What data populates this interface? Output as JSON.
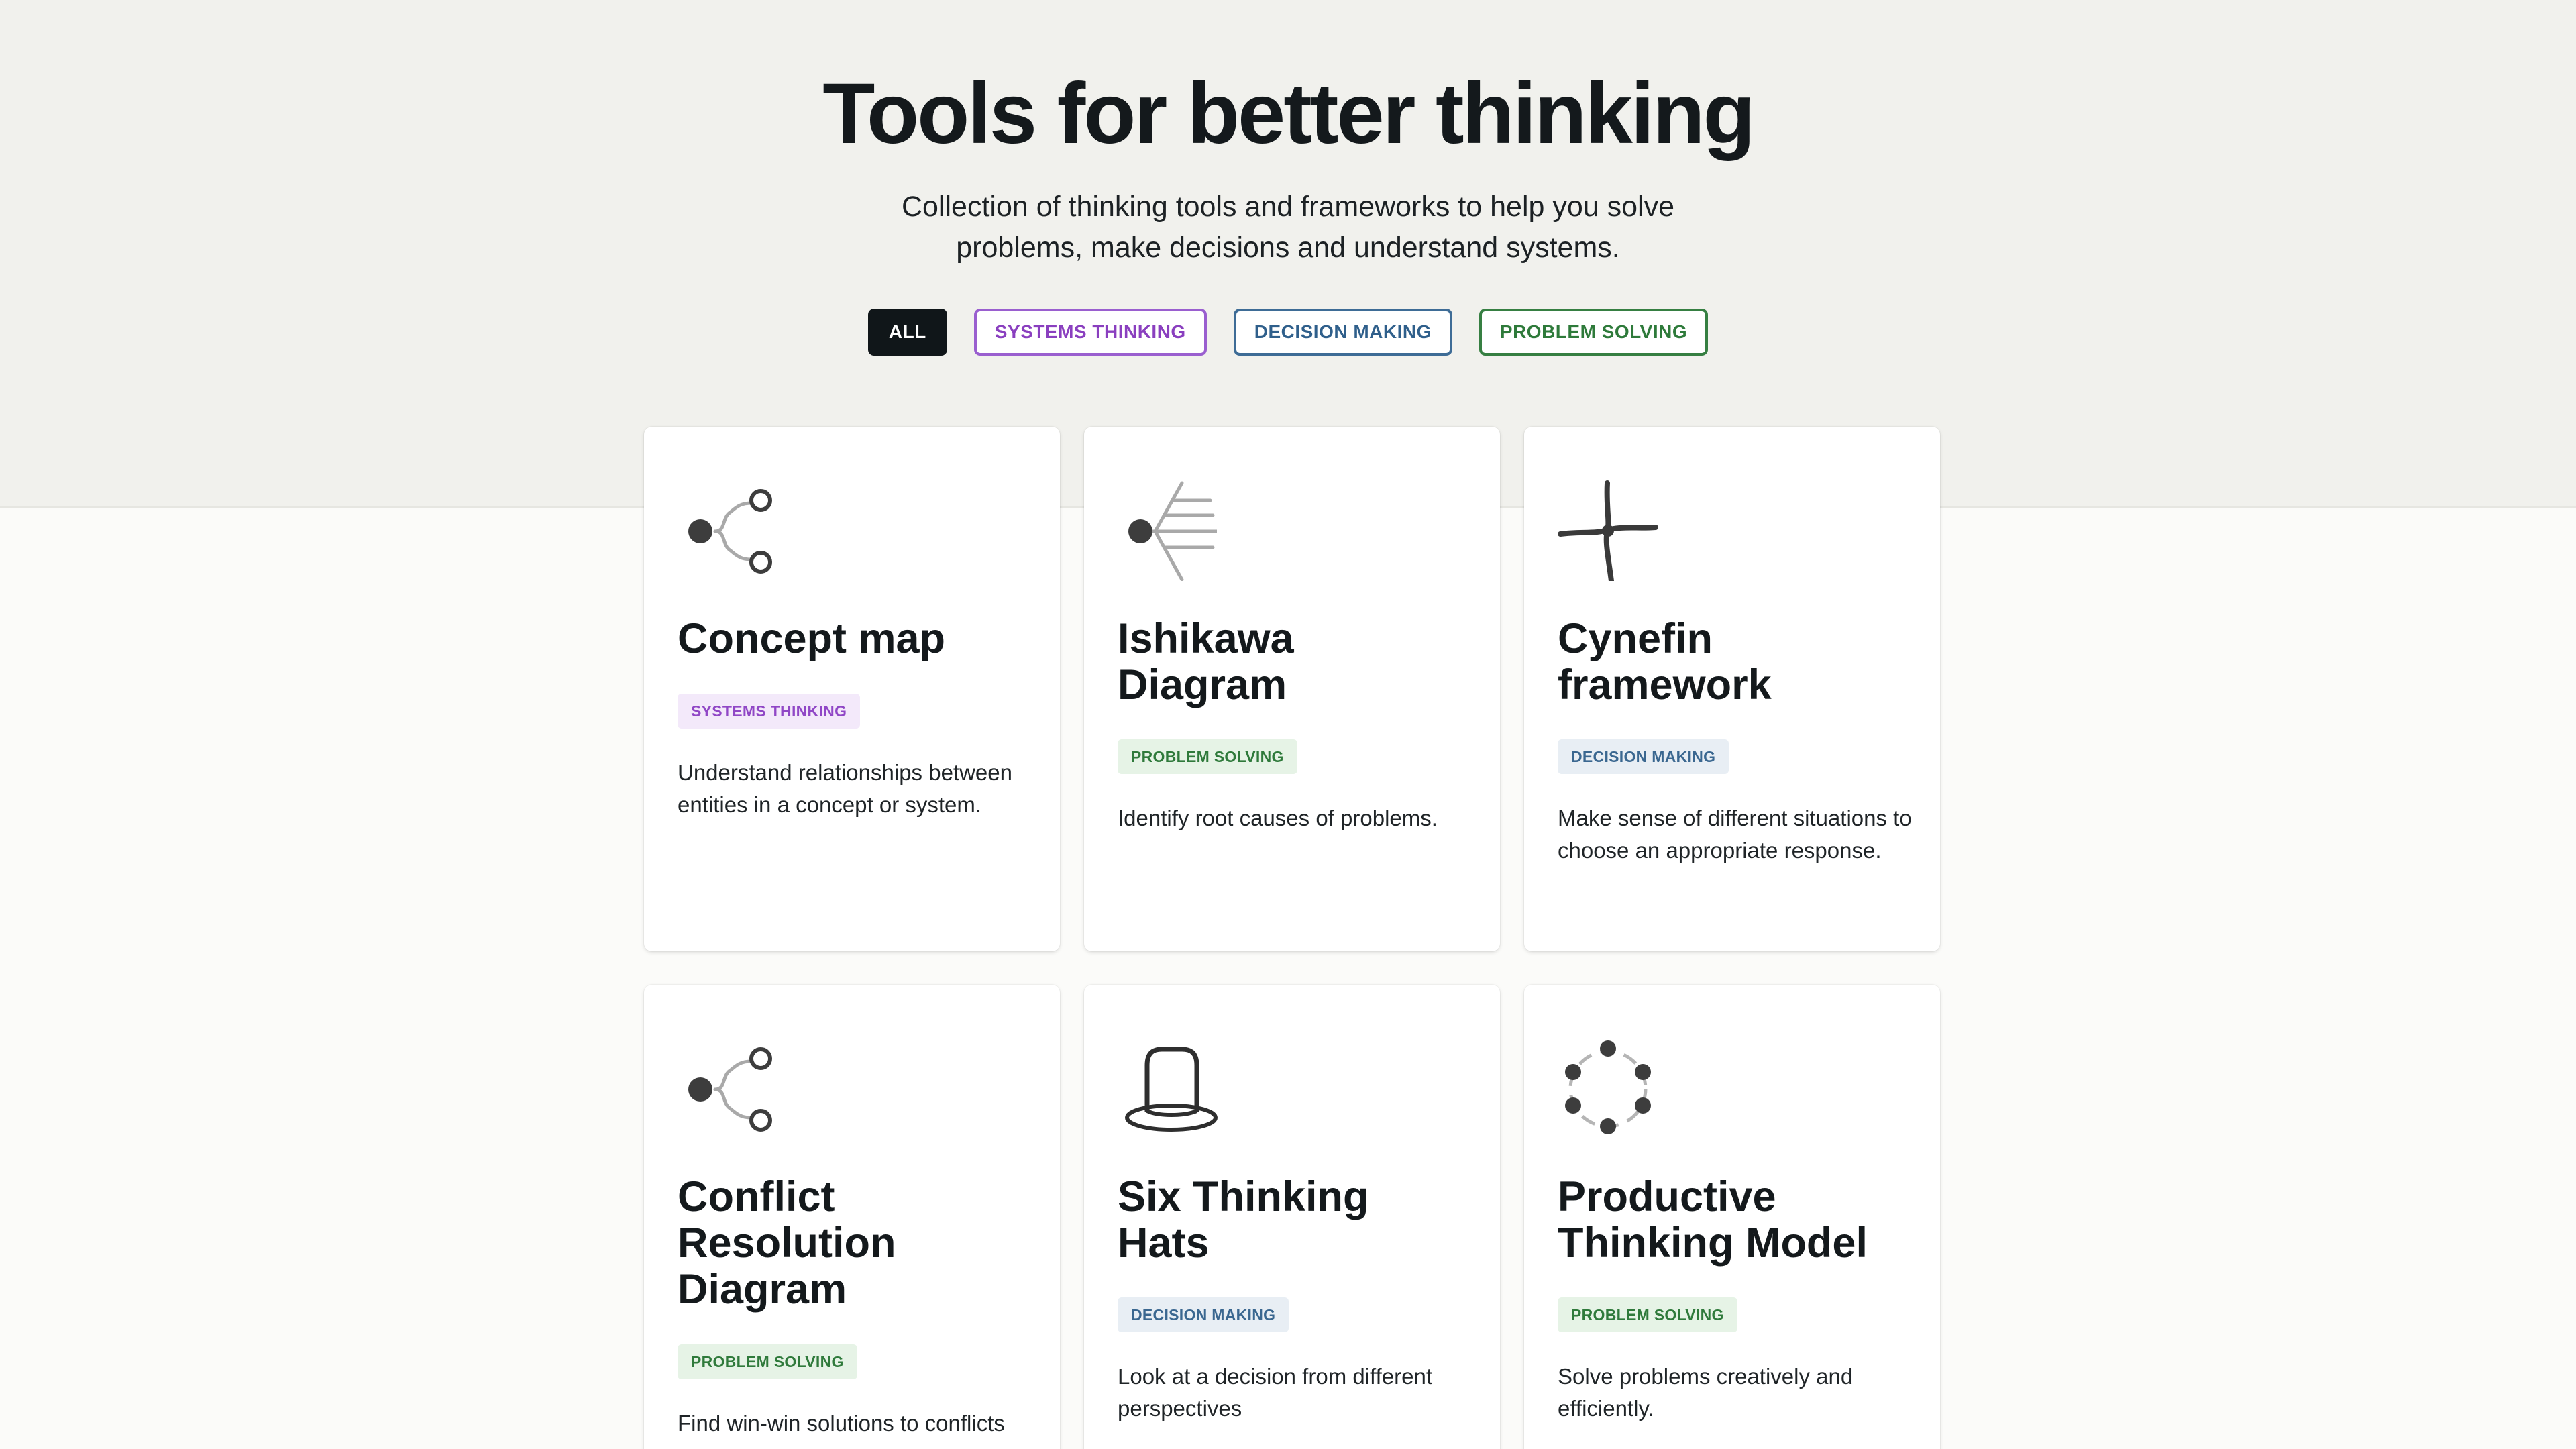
{
  "page": {
    "title": "Tools for better thinking",
    "subtitle": "Collection of thinking tools and frameworks to help you solve problems, make decisions and understand systems."
  },
  "filters": [
    {
      "label": "ALL",
      "active": true
    },
    {
      "label": "SYSTEMS THINKING",
      "active": false
    },
    {
      "label": "DECISION MAKING",
      "active": false
    },
    {
      "label": "PROBLEM SOLVING",
      "active": false
    }
  ],
  "cards": [
    {
      "title": "Concept map",
      "tag": "SYSTEMS THINKING",
      "description": "Understand relationships between entities in a concept or system.",
      "icon": "concept-map-icon"
    },
    {
      "title": "Ishikawa Diagram",
      "tag": "PROBLEM SOLVING",
      "description": "Identify root causes of problems.",
      "icon": "fishbone-icon"
    },
    {
      "title": "Cynefin framework",
      "tag": "DECISION MAKING",
      "description": "Make sense of different situations to choose an appropriate response.",
      "icon": "cynefin-icon"
    },
    {
      "title": "Conflict Resolution Diagram",
      "tag": "PROBLEM SOLVING",
      "description": "Find win-win solutions to conflicts",
      "icon": "conflict-diagram-icon"
    },
    {
      "title": "Six Thinking Hats",
      "tag": "DECISION MAKING",
      "description": "Look at a decision from different perspectives",
      "icon": "hat-icon"
    },
    {
      "title": "Productive Thinking Model",
      "tag": "PROBLEM SOLVING",
      "description": "Solve problems creatively and efficiently.",
      "icon": "cycle-dots-icon"
    }
  ],
  "colors": {
    "systems": "#9047c6",
    "decision": "#3a6790",
    "problem": "#2f7a3b",
    "ink": "#14191c"
  }
}
